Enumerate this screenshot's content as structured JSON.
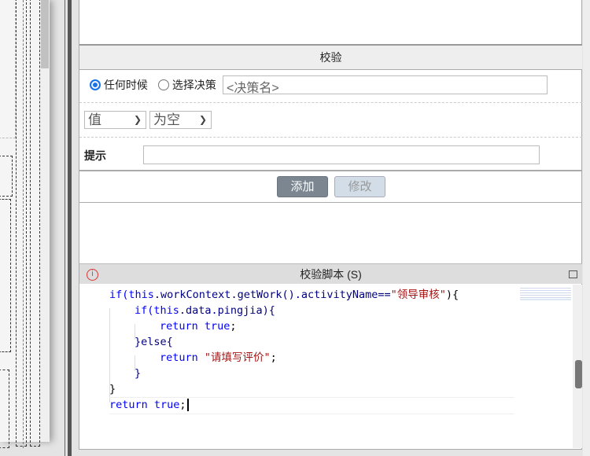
{
  "validation": {
    "title": "校验",
    "radio_any": "任何时候",
    "radio_select": "选择决策",
    "decision_placeholder": "<决策名>",
    "field_select": "值",
    "condition_select": "为空",
    "hint_label": "提示",
    "hint_value": "",
    "add_label": "添加",
    "modify_label": "修改"
  },
  "script": {
    "title": "校验脚本 (S)",
    "lines": [
      [
        "if(",
        "this",
        ".workContext.getWork().activityName==",
        "\"领导审核\"",
        "){"
      ],
      [
        "if(",
        "this",
        ".data.pingjia){"
      ],
      [
        "return",
        " true",
        ";"
      ],
      [
        "}else{"
      ],
      [
        "return",
        " \"请填写评价\"",
        ";"
      ],
      [
        "}"
      ],
      [
        "}"
      ],
      [
        "return",
        " true",
        ";"
      ]
    ]
  },
  "colors": {
    "accent": "#1a73e8",
    "add_button": "#7b8691",
    "modify_button": "#d2dde7"
  }
}
